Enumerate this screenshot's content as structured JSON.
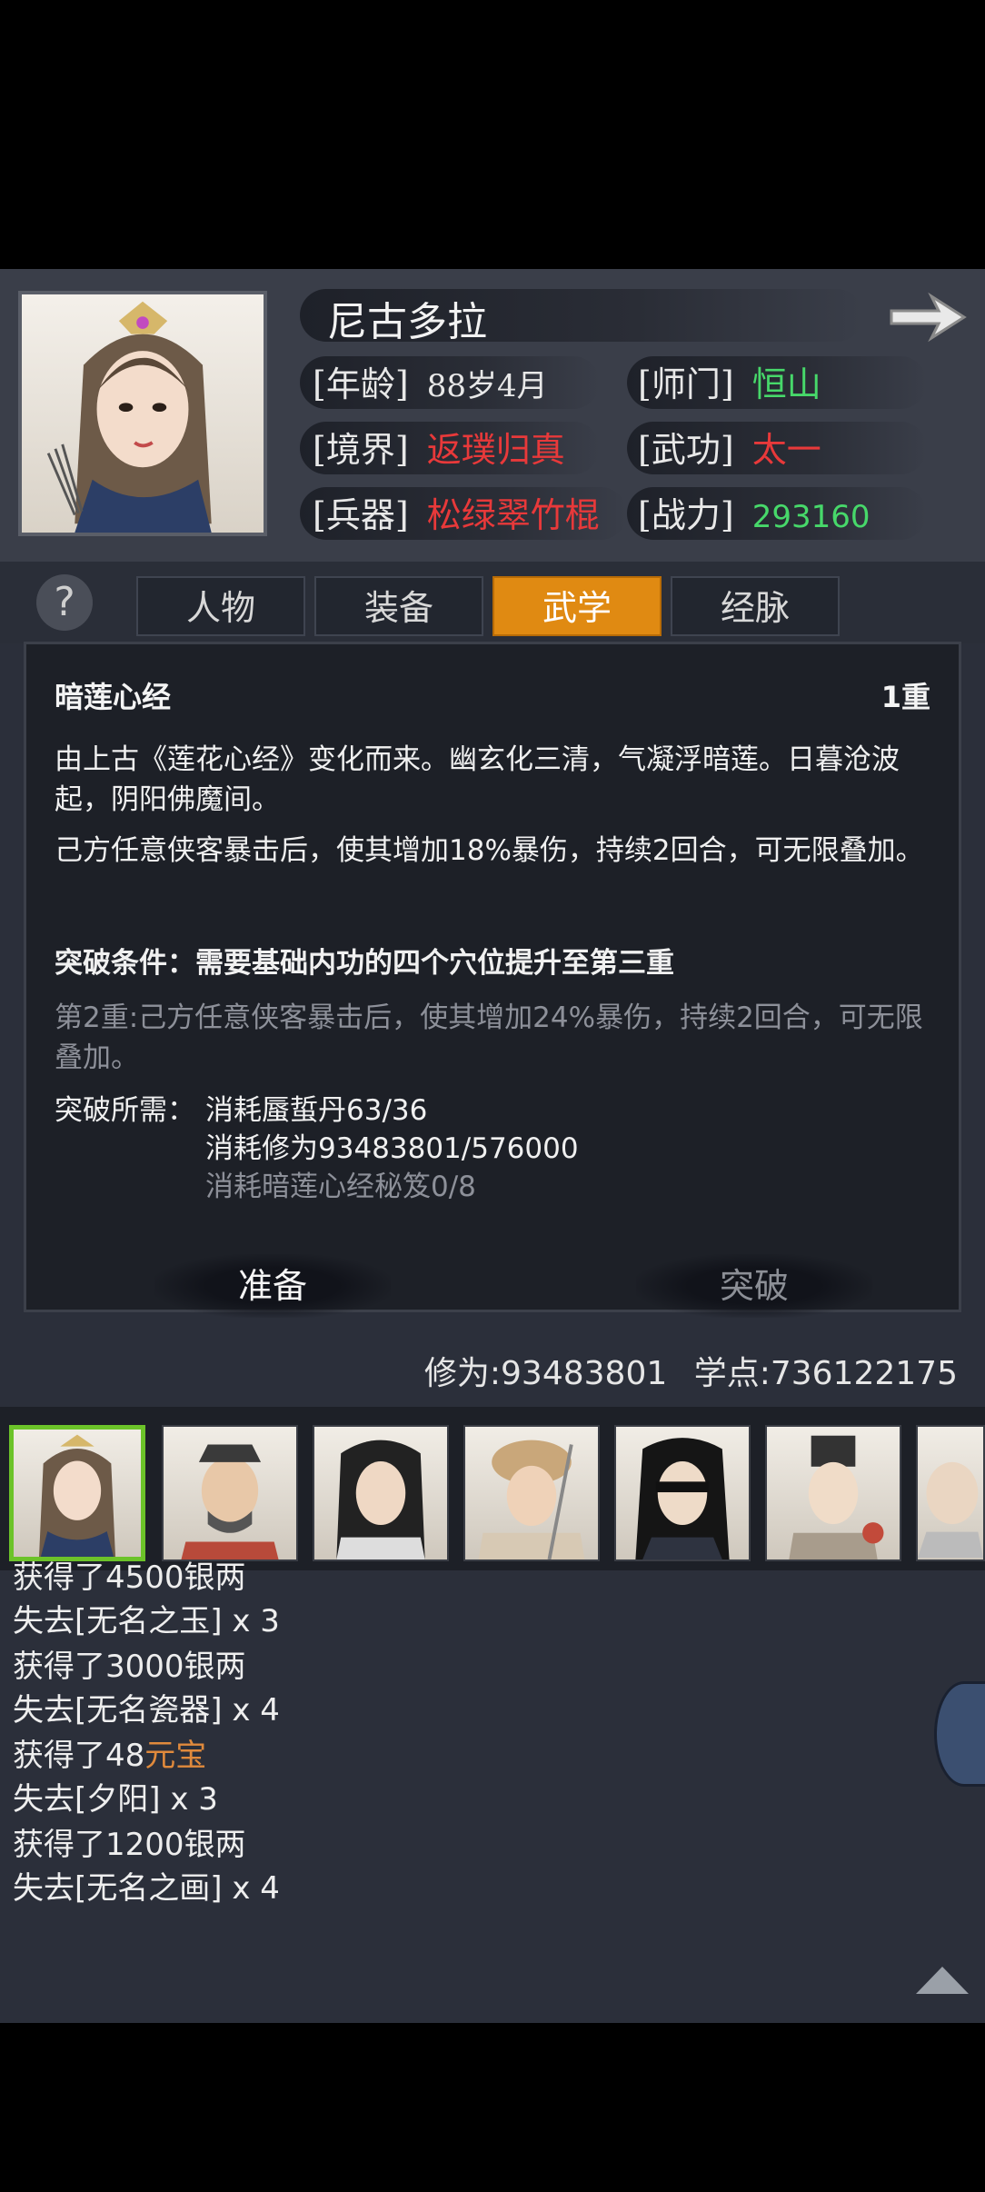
{
  "character": {
    "name": "尼古多拉",
    "age_label": "[年龄]",
    "age_value": "88岁4月",
    "sect_label": "[师门]",
    "sect_value": "恒山",
    "realm_label": "[境界]",
    "realm_value": "返璞归真",
    "skill_label": "[武功]",
    "skill_value": "太一",
    "weapon_label": "[兵器]",
    "weapon_value": "松绿翠竹棍",
    "power_label": "[战力]",
    "power_value": "293160"
  },
  "tabs": [
    {
      "label": "人物",
      "active": false
    },
    {
      "label": "装备",
      "active": false
    },
    {
      "label": "武学",
      "active": true
    },
    {
      "label": "经脉",
      "active": false
    }
  ],
  "help_symbol": "?",
  "detail": {
    "title": "暗莲心经",
    "level": "1重",
    "description": "由上古《莲花心经》变化而来。幽玄化三清，气凝浮暗莲。日暮沧波起，阴阳佛魔间。",
    "effect": "己方任意侠客暴击后，使其增加18%暴伤，持续2回合，可无限叠加。",
    "breakthrough_condition": "突破条件：需要基础内功的四个穴位提升至第三重",
    "next_level": "第2重:己方任意侠客暴击后，使其增加24%暴伤，持续2回合，可无限叠加。",
    "req_label": "突破所需：",
    "req_1": "消耗蜃蜇丹63/36",
    "req_2": "消耗修为93483801/576000",
    "req_3": "消耗暗莲心经秘笈0/8",
    "prepare_button": "准备",
    "breakthrough_button": "突破"
  },
  "stats": {
    "cultivation": "修为:93483801",
    "study_points": "学点:736122175"
  },
  "log": [
    {
      "prefix": "获得了4500银两",
      "suffix": ""
    },
    {
      "prefix": "失去[无名之玉] x 3",
      "suffix": ""
    },
    {
      "prefix": "获得了3000银两",
      "suffix": ""
    },
    {
      "prefix": "失去[无名瓷器] x 4",
      "suffix": ""
    },
    {
      "prefix": "获得了48",
      "suffix": "元宝"
    },
    {
      "prefix": "失去[夕阳] x 3",
      "suffix": ""
    },
    {
      "prefix": "获得了1200银两",
      "suffix": ""
    },
    {
      "prefix": "失去[无名之画] x 4",
      "suffix": ""
    }
  ],
  "colors": {
    "active_tab": "#e08a12",
    "red_value": "#e8393a",
    "green_value": "#47d86a",
    "gold_text": "#e08a3c",
    "selected_border": "#6cc329"
  }
}
